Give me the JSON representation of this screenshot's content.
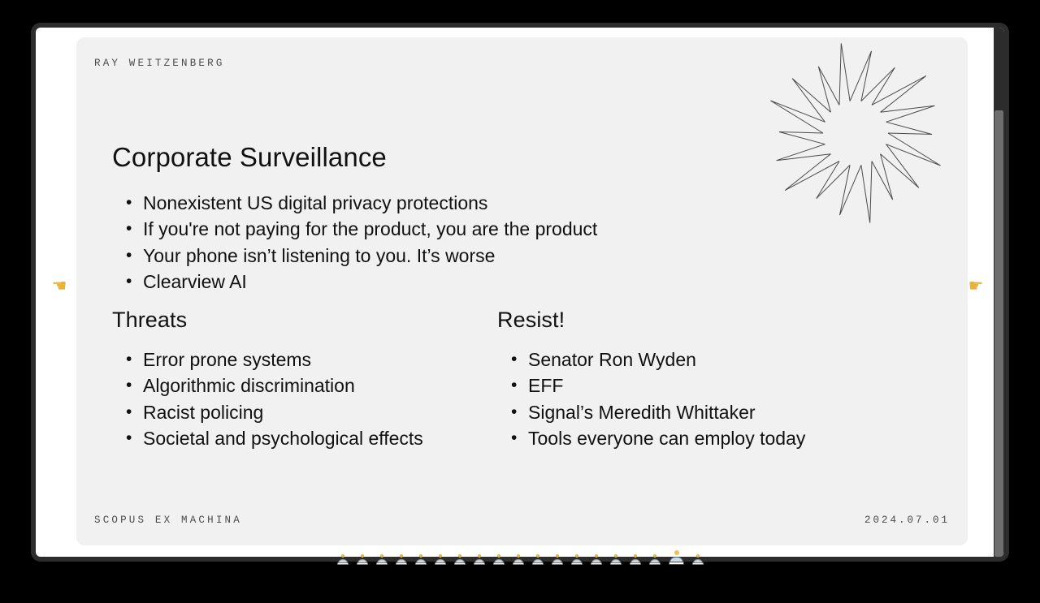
{
  "window": {
    "frame_color": "#2c2c2c",
    "page_background": "#ffffff"
  },
  "scrollbar": {
    "track_color": "#2c2c2c",
    "thumb_color": "#6e6e6e"
  },
  "slide": {
    "background": "#f1f1f1",
    "author": "RAY WEITZENBERG",
    "title": "Corporate Surveillance",
    "series": "SCOPUS EX MACHINA",
    "date": "2024.07.01",
    "bullets": [
      "Nonexistent US digital privacy protections",
      "If you're not paying for the product, you are the product",
      "Your phone isn’t listening to you. It’s worse",
      "Clearview AI"
    ],
    "sections": [
      {
        "heading": "Threats",
        "bullets": [
          "Error prone systems",
          "Algorithmic discrimination",
          "Racist policing",
          "Societal and psychological effects"
        ]
      },
      {
        "heading": "Resist!",
        "bullets": [
          "Senator Ron Wyden",
          "EFF",
          "Signal’s Meredith Whittaker",
          "Tools everyone can employ today"
        ]
      }
    ],
    "decoration": {
      "name": "starburst-spiral",
      "stroke_color": "#4a4a4a"
    }
  },
  "navigation": {
    "prev_label": "☚",
    "next_label": "☛",
    "hand_color": "#e8b33c"
  },
  "thumbnails": {
    "count": 19,
    "active_index": 17,
    "accent_color": "#e8b33c"
  }
}
